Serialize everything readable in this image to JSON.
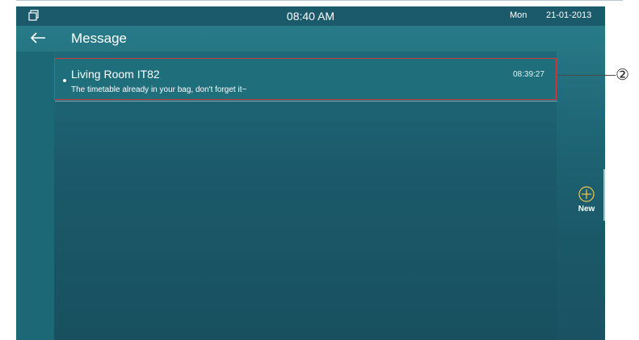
{
  "status": {
    "time": "08:40 AM",
    "day": "Mon",
    "date": "21-01-2013"
  },
  "header": {
    "title": "Message"
  },
  "messages": [
    {
      "title": "Living Room IT82",
      "body": "The timetable already in your bag, don't forget it~",
      "time": "08:39:27"
    }
  ],
  "actions": {
    "new_label": "New"
  },
  "callout": {
    "label": "②"
  },
  "colors": {
    "accent_new": "#f2c94c",
    "highlight_border": "#d23b3b"
  },
  "icons": {
    "status": "window-restore-icon",
    "back": "arrow-left-icon",
    "new": "plus-circle-icon"
  }
}
